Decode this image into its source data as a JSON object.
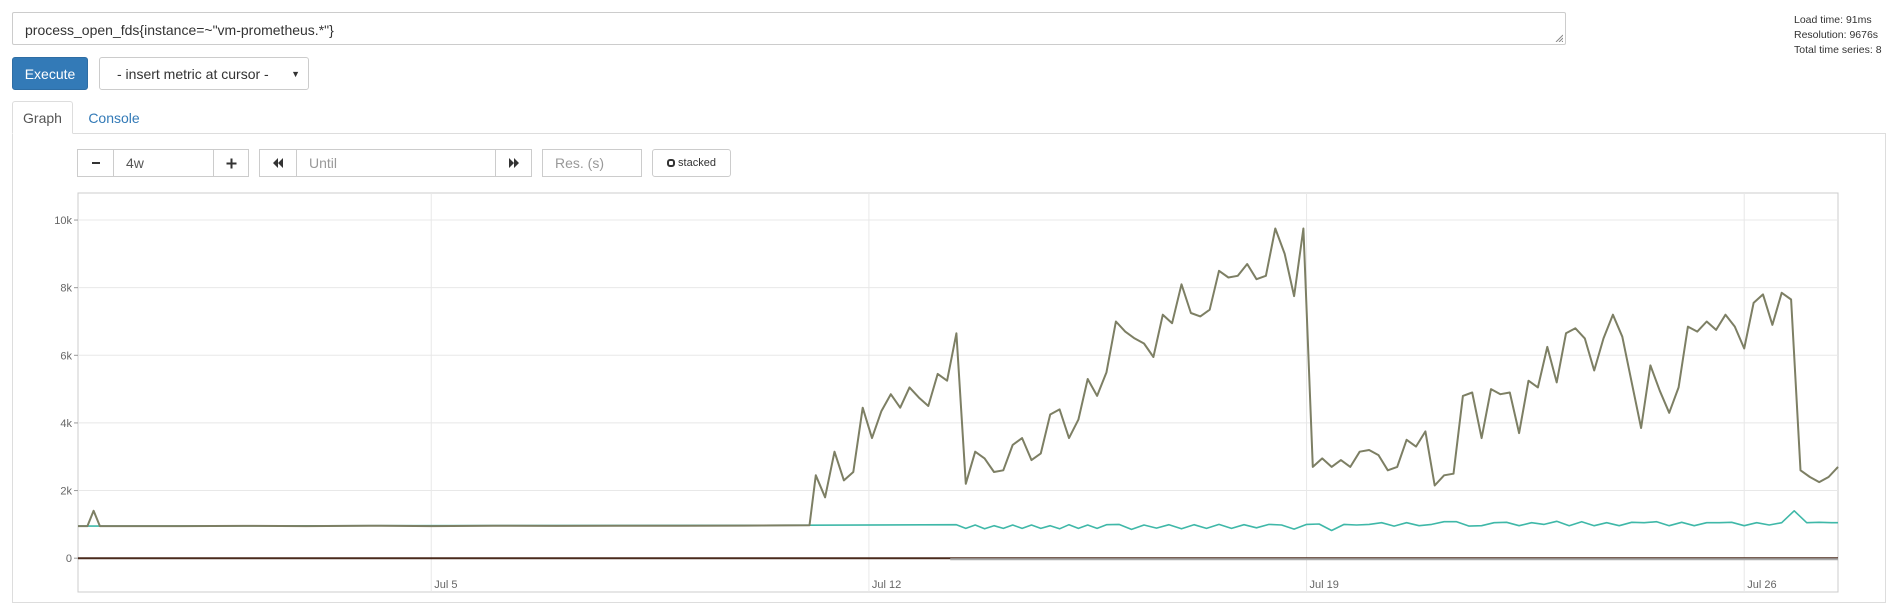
{
  "query": {
    "expression": "process_open_fds{instance=~\"vm-prometheus.*\"}"
  },
  "stats": {
    "load_time": "Load time: 91ms",
    "resolution": "Resolution: 9676s",
    "total_series": "Total time series: 8"
  },
  "toolbar": {
    "execute_label": "Execute",
    "insert_metric_label": "- insert metric at cursor -"
  },
  "tabs": [
    {
      "label": "Graph",
      "active": true
    },
    {
      "label": "Console",
      "active": false
    }
  ],
  "graph_controls": {
    "minus_icon": "minus-icon",
    "range_value": "4w",
    "plus_icon": "plus-icon",
    "back_icon": "backward-icon",
    "until_placeholder": "Until",
    "forward_icon": "forward-icon",
    "resolution_placeholder": "Res. (s)",
    "stacked_label": "stacked"
  },
  "colors": {
    "accent": "#337ab7",
    "series_main": "#7d7f64",
    "series_teal": "#3fb8a8",
    "series_base": "#4a2a1c"
  },
  "chart_data": {
    "type": "line",
    "ylim": [
      -1000,
      10800
    ],
    "y_ticks": [
      0,
      2000,
      4000,
      6000,
      8000,
      10000
    ],
    "y_tick_labels": [
      "0",
      "2k",
      "4k",
      "6k",
      "8k",
      "10k"
    ],
    "x_tick_labels": [
      "Jul 5",
      "Jul 12",
      "Jul 19",
      "Jul 26"
    ],
    "x_ticks": [
      5,
      12,
      19,
      26
    ],
    "xlim": [
      -0.65,
      27.5
    ],
    "series": [
      {
        "values": [
          [
            -0.65,
            950
          ],
          [
            -0.5,
            950
          ],
          [
            -0.4,
            1400
          ],
          [
            -0.3,
            950
          ],
          [
            1,
            950
          ],
          [
            2,
            955
          ],
          [
            3,
            950
          ],
          [
            4,
            960
          ],
          [
            5,
            950
          ],
          [
            6,
            960
          ],
          [
            7,
            955
          ],
          [
            8,
            960
          ],
          [
            9,
            960
          ],
          [
            10,
            965
          ],
          [
            11.05,
            975
          ],
          [
            11.15,
            2450
          ],
          [
            11.3,
            1800
          ],
          [
            11.45,
            3150
          ],
          [
            11.6,
            2300
          ],
          [
            11.75,
            2550
          ],
          [
            11.9,
            4450
          ],
          [
            12.05,
            3550
          ],
          [
            12.2,
            4350
          ],
          [
            12.35,
            4850
          ],
          [
            12.5,
            4450
          ],
          [
            12.65,
            5050
          ],
          [
            12.8,
            4750
          ],
          [
            12.95,
            4500
          ],
          [
            13.1,
            5450
          ],
          [
            13.25,
            5250
          ],
          [
            13.4,
            6650
          ],
          [
            13.55,
            2200
          ],
          [
            13.7,
            3150
          ],
          [
            13.85,
            2950
          ],
          [
            14.0,
            2550
          ],
          [
            14.15,
            2600
          ],
          [
            14.3,
            3350
          ],
          [
            14.45,
            3550
          ],
          [
            14.6,
            2900
          ],
          [
            14.75,
            3100
          ],
          [
            14.9,
            4250
          ],
          [
            15.05,
            4400
          ],
          [
            15.2,
            3550
          ],
          [
            15.35,
            4100
          ],
          [
            15.5,
            5300
          ],
          [
            15.65,
            4800
          ],
          [
            15.8,
            5500
          ],
          [
            15.95,
            7000
          ],
          [
            16.1,
            6700
          ],
          [
            16.25,
            6500
          ],
          [
            16.4,
            6350
          ],
          [
            16.55,
            5950
          ],
          [
            16.7,
            7200
          ],
          [
            16.85,
            6950
          ],
          [
            17.0,
            8100
          ],
          [
            17.15,
            7250
          ],
          [
            17.3,
            7150
          ],
          [
            17.45,
            7350
          ],
          [
            17.6,
            8500
          ],
          [
            17.75,
            8300
          ],
          [
            17.9,
            8350
          ],
          [
            18.05,
            8700
          ],
          [
            18.2,
            8250
          ],
          [
            18.35,
            8350
          ],
          [
            18.5,
            9750
          ],
          [
            18.65,
            9000
          ],
          [
            18.8,
            7750
          ],
          [
            18.95,
            9750
          ],
          [
            19.1,
            2700
          ],
          [
            19.25,
            2950
          ],
          [
            19.4,
            2700
          ],
          [
            19.55,
            2900
          ],
          [
            19.7,
            2700
          ],
          [
            19.85,
            3150
          ],
          [
            20.0,
            3200
          ],
          [
            20.15,
            3050
          ],
          [
            20.3,
            2600
          ],
          [
            20.45,
            2700
          ],
          [
            20.6,
            3500
          ],
          [
            20.75,
            3300
          ],
          [
            20.9,
            3750
          ],
          [
            21.05,
            2150
          ],
          [
            21.2,
            2450
          ],
          [
            21.35,
            2500
          ],
          [
            21.5,
            4800
          ],
          [
            21.65,
            4900
          ],
          [
            21.8,
            3550
          ],
          [
            21.95,
            5000
          ],
          [
            22.1,
            4850
          ],
          [
            22.25,
            4900
          ],
          [
            22.4,
            3700
          ],
          [
            22.55,
            5250
          ],
          [
            22.7,
            5050
          ],
          [
            22.85,
            6250
          ],
          [
            23.0,
            5200
          ],
          [
            23.15,
            6650
          ],
          [
            23.3,
            6800
          ],
          [
            23.45,
            6500
          ],
          [
            23.6,
            5550
          ],
          [
            23.75,
            6500
          ],
          [
            23.9,
            7200
          ],
          [
            24.05,
            6550
          ],
          [
            24.2,
            5200
          ],
          [
            24.35,
            3850
          ],
          [
            24.5,
            5700
          ],
          [
            24.65,
            4950
          ],
          [
            24.8,
            4300
          ],
          [
            24.95,
            5050
          ],
          [
            25.1,
            6850
          ],
          [
            25.25,
            6700
          ],
          [
            25.4,
            7000
          ],
          [
            25.55,
            6750
          ],
          [
            25.7,
            7200
          ],
          [
            25.85,
            6850
          ],
          [
            26.0,
            6200
          ],
          [
            26.15,
            7550
          ],
          [
            26.3,
            7800
          ],
          [
            26.45,
            6900
          ],
          [
            26.6,
            7850
          ],
          [
            26.75,
            7650
          ],
          [
            26.9,
            2600
          ],
          [
            27.05,
            2400
          ],
          [
            27.2,
            2250
          ],
          [
            27.35,
            2400
          ],
          [
            27.5,
            2700
          ]
        ]
      },
      {
        "values": [
          [
            -0.65,
            950
          ],
          [
            11.05,
            975
          ],
          [
            13.4,
            990
          ],
          [
            13.55,
            880
          ],
          [
            13.7,
            980
          ],
          [
            13.85,
            870
          ],
          [
            14.0,
            960
          ],
          [
            14.15,
            880
          ],
          [
            14.3,
            980
          ],
          [
            14.45,
            880
          ],
          [
            14.6,
            980
          ],
          [
            14.75,
            880
          ],
          [
            14.9,
            960
          ],
          [
            15.05,
            870
          ],
          [
            15.2,
            990
          ],
          [
            15.35,
            880
          ],
          [
            15.5,
            980
          ],
          [
            15.65,
            880
          ],
          [
            15.8,
            990
          ],
          [
            16.0,
            1000
          ],
          [
            16.2,
            850
          ],
          [
            16.4,
            980
          ],
          [
            16.6,
            890
          ],
          [
            16.8,
            990
          ],
          [
            17.0,
            870
          ],
          [
            17.2,
            990
          ],
          [
            17.4,
            880
          ],
          [
            17.6,
            1000
          ],
          [
            17.8,
            880
          ],
          [
            18.0,
            990
          ],
          [
            18.2,
            900
          ],
          [
            18.4,
            1000
          ],
          [
            18.6,
            980
          ],
          [
            18.8,
            860
          ],
          [
            19.0,
            1000
          ],
          [
            19.2,
            1010
          ],
          [
            19.4,
            820
          ],
          [
            19.6,
            1000
          ],
          [
            19.8,
            980
          ],
          [
            20.0,
            1000
          ],
          [
            20.2,
            1050
          ],
          [
            20.4,
            950
          ],
          [
            20.6,
            1050
          ],
          [
            20.8,
            960
          ],
          [
            21.0,
            1000
          ],
          [
            21.2,
            1080
          ],
          [
            21.4,
            1080
          ],
          [
            21.6,
            950
          ],
          [
            21.8,
            960
          ],
          [
            22.0,
            1050
          ],
          [
            22.2,
            1060
          ],
          [
            22.4,
            960
          ],
          [
            22.6,
            1050
          ],
          [
            22.8,
            1000
          ],
          [
            23.0,
            1090
          ],
          [
            23.2,
            960
          ],
          [
            23.4,
            1080
          ],
          [
            23.6,
            960
          ],
          [
            23.8,
            1050
          ],
          [
            24.0,
            960
          ],
          [
            24.2,
            1060
          ],
          [
            24.4,
            1050
          ],
          [
            24.6,
            1080
          ],
          [
            24.8,
            960
          ],
          [
            25.0,
            1060
          ],
          [
            25.2,
            960
          ],
          [
            25.4,
            1050
          ],
          [
            25.6,
            1050
          ],
          [
            25.8,
            1060
          ],
          [
            26.0,
            960
          ],
          [
            26.2,
            1050
          ],
          [
            26.4,
            980
          ],
          [
            26.6,
            1050
          ],
          [
            26.8,
            1400
          ],
          [
            27.0,
            1050
          ],
          [
            27.2,
            1060
          ],
          [
            27.4,
            1050
          ],
          [
            27.5,
            1050
          ]
        ]
      },
      {
        "values": [
          [
            -0.65,
            0
          ],
          [
            27.5,
            0
          ]
        ]
      }
    ]
  }
}
